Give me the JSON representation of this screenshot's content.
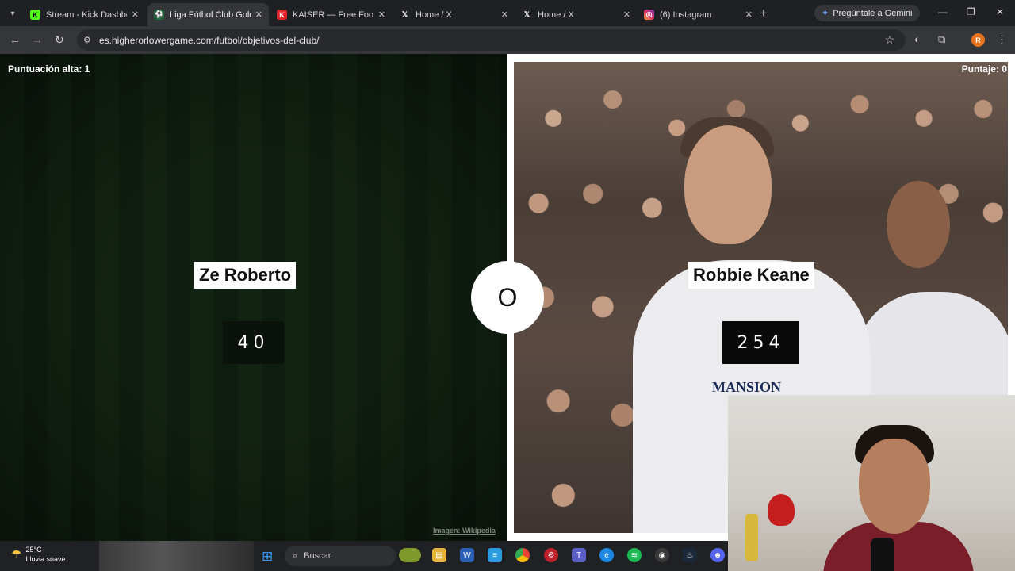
{
  "browser": {
    "tabs": [
      {
        "title": "Stream - Kick Dashboa",
        "favicon": "kick-icon",
        "color": "#53fc18"
      },
      {
        "title": "Liga Fútbol Club Goles",
        "favicon": "game-icon",
        "color": "#2dbd6e"
      },
      {
        "title": "KAISER — Free Footba",
        "favicon": "kaiser-icon",
        "color": "#e0242b"
      },
      {
        "title": "Home / X",
        "favicon": "x-icon",
        "color": "#ffffff"
      },
      {
        "title": "Home / X",
        "favicon": "x-icon",
        "color": "#ffffff"
      },
      {
        "title": "(6) Instagram",
        "favicon": "instagram-icon",
        "color": "#e1306c"
      }
    ],
    "gemini_label": "Pregúntale a Gemini",
    "url": "es.higherorlowergame.com/futbol/objetivos-del-club/",
    "profile_initial": "R"
  },
  "game": {
    "high_score_label": "Puntuación alta: 1",
    "score_label": "Puntaje: 0",
    "left": {
      "name": "Ze Roberto",
      "value": "40"
    },
    "right": {
      "name": "Robbie Keane",
      "value": "254"
    },
    "vs": "O",
    "image_credit": "Imagen: Wikipedia",
    "sponsor_text": "MANSION"
  },
  "taskbar": {
    "temperature": "25°C",
    "weather": "Lluvia suave",
    "search_placeholder": "Buscar"
  }
}
